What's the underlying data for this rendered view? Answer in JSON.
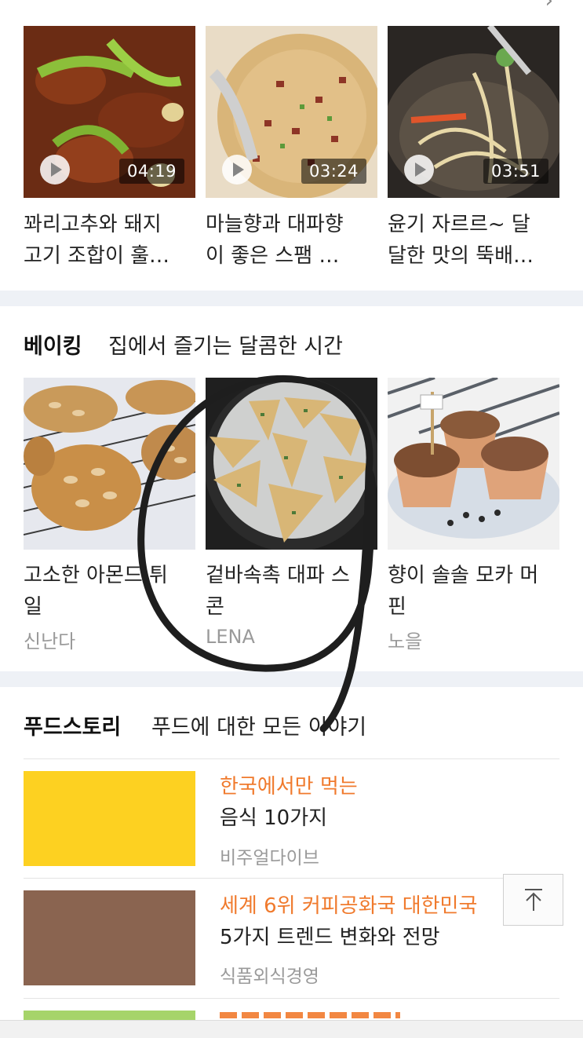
{
  "videos": [
    {
      "title_line1": "꽈리고추와 돼지",
      "title_line2": "고기 조합이 훌…",
      "duration": "04:19",
      "colors": {
        "bg": "#7a3a1c",
        "accent": "#a8c94a"
      }
    },
    {
      "title_line1": "마늘향과 대파향",
      "title_line2": "이 좋은 스팸 …",
      "duration": "03:24",
      "colors": {
        "bg": "#d8b47a",
        "accent": "#9a3e2a"
      }
    },
    {
      "title_line1": "윤기 자르르~ 달",
      "title_line2": "달한 맛의 뚝배…",
      "duration": "03:51",
      "colors": {
        "bg": "#3b3530",
        "accent": "#e7d8a8"
      }
    }
  ],
  "baking": {
    "title": "베이킹",
    "subtitle": "집에서 즐기는 달콤한 시간",
    "items": [
      {
        "title_line1": "고소한 아몬드 튀",
        "title_line2": "일",
        "author": "신난다"
      },
      {
        "title_line1": "겉바속촉 대파 스",
        "title_line2": "콘",
        "author": "LENA"
      },
      {
        "title_line1": "향이 솔솔 모카 머",
        "title_line2": "핀",
        "author": "노을"
      }
    ]
  },
  "foodstory": {
    "title": "푸드스토리",
    "subtitle": "푸드에 대한 모든 이야기",
    "items": [
      {
        "orange": "한국에서만 먹는",
        "black": "음식 10가지",
        "source": "비주얼다이브",
        "color": "#fdd121"
      },
      {
        "orange": "세계 6위 커피공화국 대한민국",
        "black": "5가지 트렌드 변화와 전망",
        "source": "식품외식경영",
        "color": "#8a6450"
      },
      {
        "orange": "",
        "black": "",
        "source": "",
        "color": "#a6d46a"
      }
    ]
  }
}
